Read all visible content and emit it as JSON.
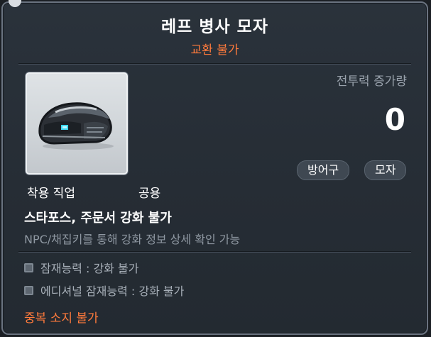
{
  "item": {
    "name": "레프 병사 모자",
    "trade_status": "교환 불가",
    "image_icon": "lef-soldier-helmet-icon"
  },
  "stats": {
    "combat_power_label": "전투력 증가량",
    "combat_power_value": "0"
  },
  "tags": [
    "방어구",
    "모자"
  ],
  "requirements": {
    "job_label": "착용 직업",
    "job_value": "공용"
  },
  "enhancement": {
    "status": "스타포스, 주문서 강화 불가",
    "hint": "NPC/채집키를 통해 강화 정보 상세 확인 가능"
  },
  "potential": {
    "items": [
      "잠재능력 : 강화 불가",
      "에디셔널 잠재능력 : 강화 불가"
    ]
  },
  "footer": {
    "unique_notice": "중복 소지 불가"
  },
  "colors": {
    "accent_orange": "#ff7a3c",
    "background": "#262d35",
    "border": "#6a7380"
  }
}
